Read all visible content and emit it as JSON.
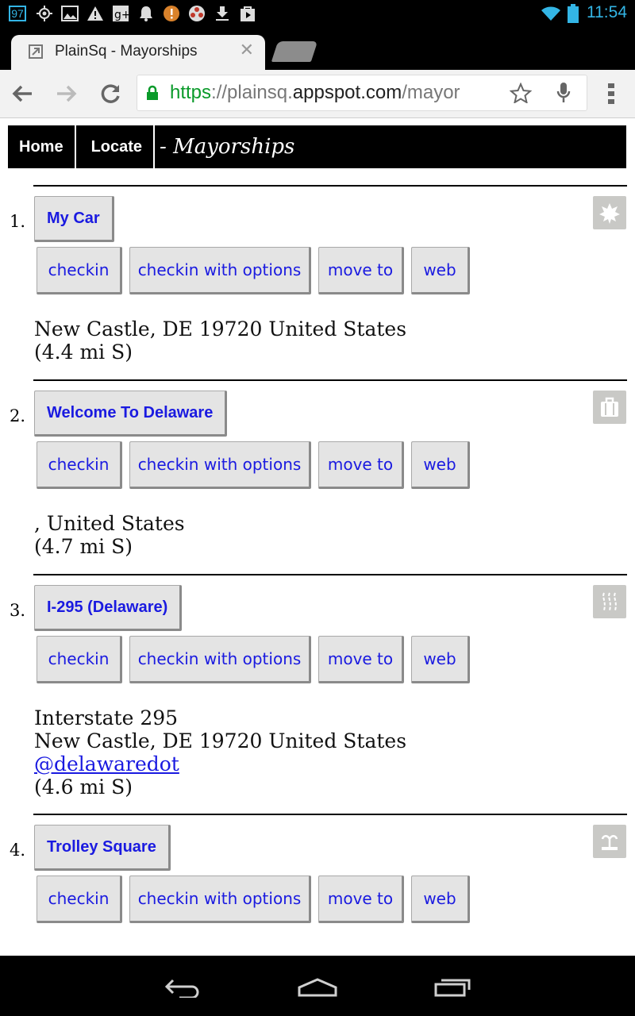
{
  "status_bar": {
    "notification_badge": "97",
    "time": "11:54",
    "icons": [
      "badge-97-icon",
      "gps-icon",
      "image-icon",
      "warning-icon",
      "google-plus-icon",
      "bell-icon",
      "alert-icon",
      "pinwheel-icon",
      "download-icon",
      "play-store-icon",
      "wifi-icon",
      "battery-icon"
    ]
  },
  "browser": {
    "tab_title": "PlainSq - Mayorships",
    "url_scheme": "https",
    "url_sep": "://",
    "url_sub": "plainsq.",
    "url_domain": "appspot.com",
    "url_path": "/mayor",
    "lock_color": "#0a9a2a"
  },
  "page": {
    "nav": {
      "home": "Home",
      "locate": "Locate",
      "title": "- Mayorships"
    },
    "entries": [
      {
        "number": "1.",
        "name": "My Car",
        "category_icon": "leaf-icon",
        "actions": [
          "checkin",
          "checkin with options",
          "move to",
          "web"
        ],
        "address_lines": [
          "New Castle, DE 19720 United States",
          "(4.4 mi S)"
        ]
      },
      {
        "number": "2.",
        "name": "Welcome To Delaware",
        "category_icon": "suitcase-icon",
        "actions": [
          "checkin",
          "checkin with options",
          "move to",
          "web"
        ],
        "address_lines": [
          ", United States",
          "(4.7 mi S)"
        ]
      },
      {
        "number": "3.",
        "name": "I-295 (Delaware)",
        "category_icon": "road-icon",
        "actions": [
          "checkin",
          "checkin with options",
          "move to",
          "web"
        ],
        "address_lines": [
          "Interstate 295",
          "New Castle, DE 19720 United States"
        ],
        "link": "@delawaredot",
        "distance": "(4.6 mi S)"
      },
      {
        "number": "4.",
        "name": "Trolley Square",
        "category_icon": "fountain-icon",
        "actions": [
          "checkin",
          "checkin with options",
          "move to",
          "web"
        ]
      }
    ]
  },
  "colors": {
    "link_blue": "#1a1ae0",
    "button_bg": "#e4e4e4",
    "status_accent": "#33b5e5"
  }
}
